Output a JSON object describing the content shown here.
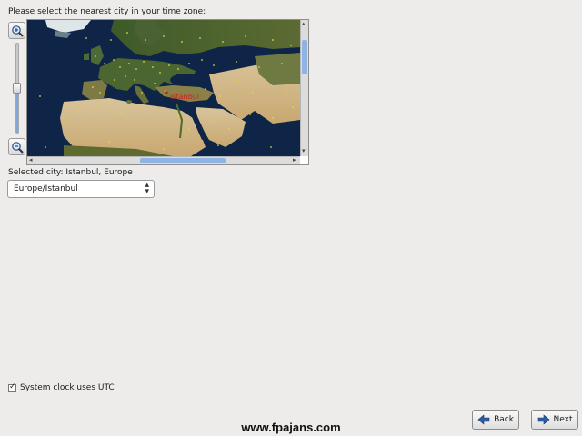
{
  "prompt": "Please select the nearest city in your time zone:",
  "map": {
    "selected_marker_label": "Istanbul",
    "zoom_in_icon": "zoom-in-icon",
    "zoom_out_icon": "zoom-out-icon",
    "zoom_level_fraction": 0.55
  },
  "selected_city": "Selected city: Istanbul, Europe",
  "timezone_select": {
    "value": "Europe/Istanbul"
  },
  "utc_checkbox": {
    "label": "System clock uses UTC",
    "checked": true
  },
  "watermark": "www.fpajans.com",
  "buttons": {
    "back": "Back",
    "next": "Next"
  },
  "colors": {
    "accent": "#8fb3e3",
    "marker": "#e0d840",
    "selected_marker": "#cc2222",
    "ocean": "#0f2548"
  }
}
